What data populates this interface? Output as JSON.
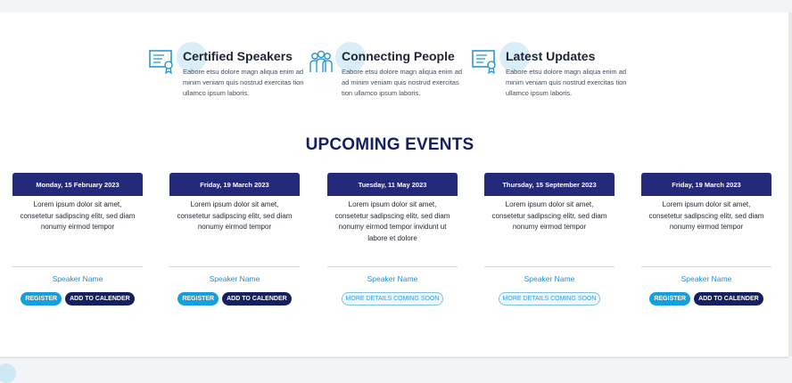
{
  "features": [
    {
      "icon": "certificate-icon",
      "title": "Certified Speakers",
      "desc": "Eabore etsu dolore magn aliqua enim ad minim veniam quis nostrud exercitas tion ullamco ipsum laboris."
    },
    {
      "icon": "people-group-icon",
      "title": "Connecting People",
      "desc": "Eabore etsu dolore magn aliqua enim ad ad minim veniam quis nostrud exercitas tion ullamco ipsum laboris."
    },
    {
      "icon": "certificate-icon",
      "title": "Latest Updates",
      "desc": "Eabore etsu dolore magn aliqua enim ad minim veniam quis nostrud exercitas tion ullamco ipsum laboris."
    }
  ],
  "section": {
    "title": "UPCOMING EVENTS"
  },
  "events": [
    {
      "date": "Monday, 15 February 2023",
      "desc": "Lorem ipsum dolor sit amet, consetetur sadipscing elitr, sed diam nonumy eirmod tempor",
      "speaker": "Speaker Name",
      "register": "REGISTER",
      "calendar": "ADD TO CALENDER"
    },
    {
      "date": "Friday, 19 March 2023",
      "desc": "Lorem ipsum dolor sit amet, consetetur sadipscing elitr, sed diam nonumy eirmod tempor",
      "speaker": "Speaker Name",
      "register": "REGISTER",
      "calendar": "ADD TO CALENDER"
    },
    {
      "date": "Tuesday, 11 May 2023",
      "desc": "Lorem ipsum dolor sit amet, consetetur sadipscing elitr, sed diam nonumy eirmod tempor invidunt ut labore et dolore",
      "speaker": "Speaker Name",
      "more": "MORE DETAILS COMING SOON"
    },
    {
      "date": "Thursday, 15 September 2023",
      "desc": "Lorem ipsum dolor sit amet, consetetur sadipscing elitr, sed diam nonumy eirmod tempor",
      "speaker": "Speaker Name",
      "more": "MORE DETAILS COMING SOON"
    },
    {
      "date": "Friday, 19 March 2023",
      "desc": "Lorem ipsum dolor sit amet, consetetur sadipscing elitr, sed diam nonumy eirmod tempor",
      "speaker": "Speaker Name",
      "register": "REGISTER",
      "calendar": "ADD TO CALENDER"
    }
  ],
  "colors": {
    "accent": "#14a0dc",
    "navy": "#152063",
    "header": "#24297a"
  }
}
